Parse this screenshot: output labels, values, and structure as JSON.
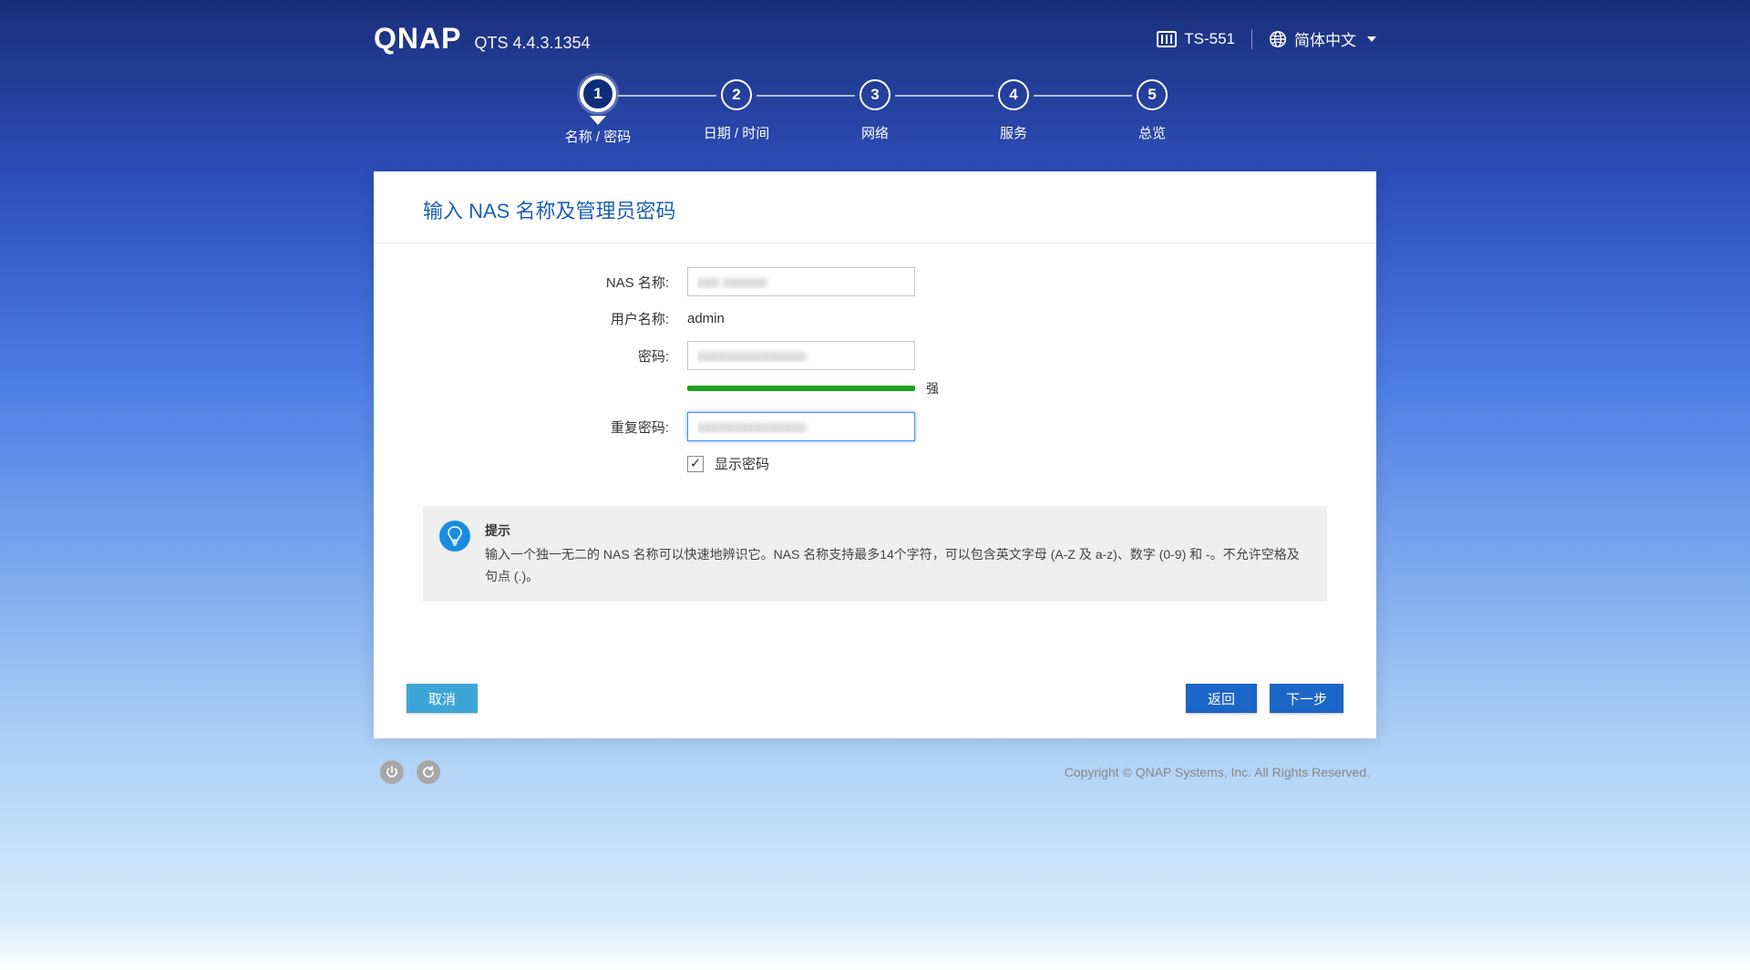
{
  "header": {
    "logo": "QNAP",
    "version": "QTS 4.4.3.1354",
    "model": "TS-551",
    "language": "简体中文"
  },
  "stepper": {
    "active_index": 0,
    "steps": [
      {
        "num": "1",
        "label": "名称 / 密码"
      },
      {
        "num": "2",
        "label": "日期 / 时间"
      },
      {
        "num": "3",
        "label": "网络"
      },
      {
        "num": "4",
        "label": "服务"
      },
      {
        "num": "5",
        "label": "总览"
      }
    ]
  },
  "card": {
    "title": "输入 NAS 名称及管理员密码",
    "fields": {
      "nas_name_label": "NAS 名称:",
      "nas_name_value": "xxx xxxxxx",
      "username_label": "用户名称:",
      "username_value": "admin",
      "password_label": "密码:",
      "password_value": "xxxxxxxxxxxxxxx",
      "strength_label": "强",
      "repeat_password_label": "重复密码:",
      "repeat_password_value": "xxxxxxxxxxxxxxx",
      "show_password_label": "显示密码",
      "show_password_checked": true
    },
    "hint": {
      "title": "提示",
      "body": "输入一个独一无二的 NAS 名称可以快速地辨识它。NAS 名称支持最多14个字符，可以包含英文字母 (A-Z 及 a-z)、数字 (0-9) 和 -。不允许空格及句点 (.)。"
    },
    "buttons": {
      "cancel": "取消",
      "back": "返回",
      "next": "下一步"
    }
  },
  "footer": {
    "copyright": "Copyright © QNAP Systems, Inc. All Rights Reserved."
  }
}
